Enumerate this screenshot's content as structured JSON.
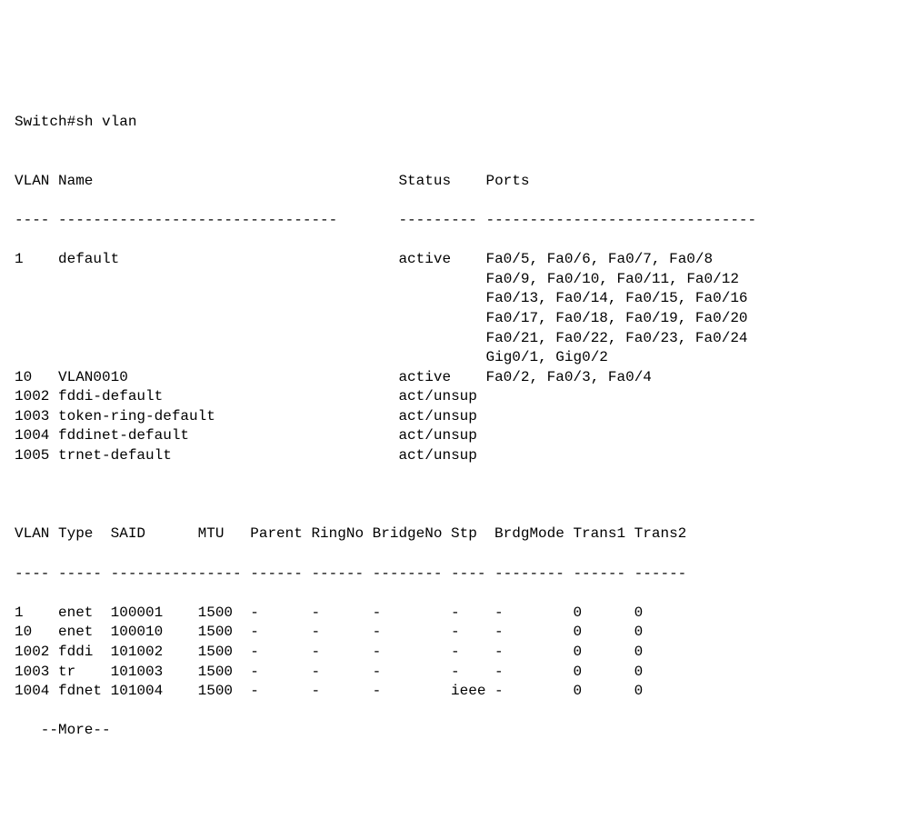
{
  "command": "Switch#sh vlan",
  "table1": {
    "headers": {
      "vlan": "VLAN",
      "name": "Name",
      "status": "Status",
      "ports": "Ports"
    },
    "dashes": {
      "vlan": "----",
      "name": "--------------------------------",
      "status": "---------",
      "ports": "-------------------------------"
    },
    "rows": [
      {
        "vlan": "1",
        "name": "default",
        "status": "active",
        "ports": "Fa0/5, Fa0/6, Fa0/7, Fa0/8",
        "ports_extra": [
          "Fa0/9, Fa0/10, Fa0/11, Fa0/12",
          "Fa0/13, Fa0/14, Fa0/15, Fa0/16",
          "Fa0/17, Fa0/18, Fa0/19, Fa0/20",
          "Fa0/21, Fa0/22, Fa0/23, Fa0/24",
          "Gig0/1, Gig0/2"
        ]
      },
      {
        "vlan": "10",
        "name": "VLAN0010",
        "status": "active",
        "ports": "Fa0/2, Fa0/3, Fa0/4",
        "ports_extra": []
      },
      {
        "vlan": "1002",
        "name": "fddi-default",
        "status": "act/unsup",
        "ports": "",
        "ports_extra": []
      },
      {
        "vlan": "1003",
        "name": "token-ring-default",
        "status": "act/unsup",
        "ports": "",
        "ports_extra": []
      },
      {
        "vlan": "1004",
        "name": "fddinet-default",
        "status": "act/unsup",
        "ports": "",
        "ports_extra": []
      },
      {
        "vlan": "1005",
        "name": "trnet-default",
        "status": "act/unsup",
        "ports": "",
        "ports_extra": []
      }
    ]
  },
  "table2": {
    "headers": {
      "vlan": "VLAN",
      "type": "Type",
      "said": "SAID",
      "mtu": "MTU",
      "parent": "Parent",
      "ringno": "RingNo",
      "bridgeno": "BridgeNo",
      "stp": "Stp",
      "brdgmode": "BrdgMode",
      "trans1": "Trans1",
      "trans2": "Trans2"
    },
    "dashes": {
      "vlan": "----",
      "type": "-----",
      "said": "----------",
      "mtu": "-----",
      "parent": "------",
      "ringno": "------",
      "bridgeno": "--------",
      "stp": "----",
      "brdgmode": "--------",
      "trans1": "------",
      "trans2": "------"
    },
    "rows": [
      {
        "vlan": "1",
        "type": "enet",
        "said": "100001",
        "mtu": "1500",
        "parent": "-",
        "ringno": "-",
        "bridgeno": "-",
        "stp": "-",
        "brdgmode": "-",
        "trans1": "0",
        "trans2": "0"
      },
      {
        "vlan": "10",
        "type": "enet",
        "said": "100010",
        "mtu": "1500",
        "parent": "-",
        "ringno": "-",
        "bridgeno": "-",
        "stp": "-",
        "brdgmode": "-",
        "trans1": "0",
        "trans2": "0"
      },
      {
        "vlan": "1002",
        "type": "fddi",
        "said": "101002",
        "mtu": "1500",
        "parent": "-",
        "ringno": "-",
        "bridgeno": "-",
        "stp": "-",
        "brdgmode": "-",
        "trans1": "0",
        "trans2": "0"
      },
      {
        "vlan": "1003",
        "type": "tr",
        "said": "101003",
        "mtu": "1500",
        "parent": "-",
        "ringno": "-",
        "bridgeno": "-",
        "stp": "-",
        "brdgmode": "-",
        "trans1": "0",
        "trans2": "0"
      },
      {
        "vlan": "1004",
        "type": "fdnet",
        "said": "101004",
        "mtu": "1500",
        "parent": "-",
        "ringno": "-",
        "bridgeno": "-",
        "stp": "ieee",
        "brdgmode": "-",
        "trans1": "0",
        "trans2": "0"
      }
    ]
  },
  "more": "--More--"
}
